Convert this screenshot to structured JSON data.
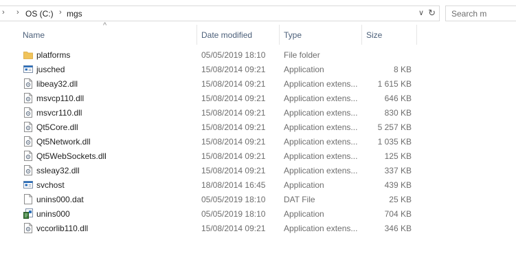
{
  "address": {
    "crumbs": [
      "OS (C:)",
      "mgs"
    ],
    "separator_glyph": "›",
    "dropdown_glyph": "∨",
    "refresh_glyph": "↻"
  },
  "search": {
    "placeholder": "Search m"
  },
  "columns": {
    "name": "Name",
    "date": "Date modified",
    "type": "Type",
    "size": "Size",
    "sort_glyph": "^"
  },
  "files": [
    {
      "name": "platforms",
      "date": "05/05/2019 18:10",
      "type": "File folder",
      "size": "",
      "icon": "folder-icon"
    },
    {
      "name": "jusched",
      "date": "15/08/2014 09:21",
      "type": "Application",
      "size": "8 KB",
      "icon": "application-icon"
    },
    {
      "name": "libeay32.dll",
      "date": "15/08/2014 09:21",
      "type": "Application extens...",
      "size": "1 615 KB",
      "icon": "dll-file-icon"
    },
    {
      "name": "msvcp110.dll",
      "date": "15/08/2014 09:21",
      "type": "Application extens...",
      "size": "646 KB",
      "icon": "dll-file-icon"
    },
    {
      "name": "msvcr110.dll",
      "date": "15/08/2014 09:21",
      "type": "Application extens...",
      "size": "830 KB",
      "icon": "dll-file-icon"
    },
    {
      "name": "Qt5Core.dll",
      "date": "15/08/2014 09:21",
      "type": "Application extens...",
      "size": "5 257 KB",
      "icon": "dll-file-icon"
    },
    {
      "name": "Qt5Network.dll",
      "date": "15/08/2014 09:21",
      "type": "Application extens...",
      "size": "1 035 KB",
      "icon": "dll-file-icon"
    },
    {
      "name": "Qt5WebSockets.dll",
      "date": "15/08/2014 09:21",
      "type": "Application extens...",
      "size": "125 KB",
      "icon": "dll-file-icon"
    },
    {
      "name": "ssleay32.dll",
      "date": "15/08/2014 09:21",
      "type": "Application extens...",
      "size": "337 KB",
      "icon": "dll-file-icon"
    },
    {
      "name": "svchost",
      "date": "18/08/2014 16:45",
      "type": "Application",
      "size": "439 KB",
      "icon": "application-icon"
    },
    {
      "name": "unins000.dat",
      "date": "05/05/2019 18:10",
      "type": "DAT File",
      "size": "25 KB",
      "icon": "file-icon"
    },
    {
      "name": "unins000",
      "date": "05/05/2019 18:10",
      "type": "Application",
      "size": "704 KB",
      "icon": "uninstaller-icon"
    },
    {
      "name": "vccorlib110.dll",
      "date": "15/08/2014 09:21",
      "type": "Application extens...",
      "size": "346 KB",
      "icon": "dll-file-icon"
    }
  ],
  "colors": {
    "folder": "#f0c35a",
    "app_blue": "#2d6fba",
    "header_text": "#4c607a"
  }
}
